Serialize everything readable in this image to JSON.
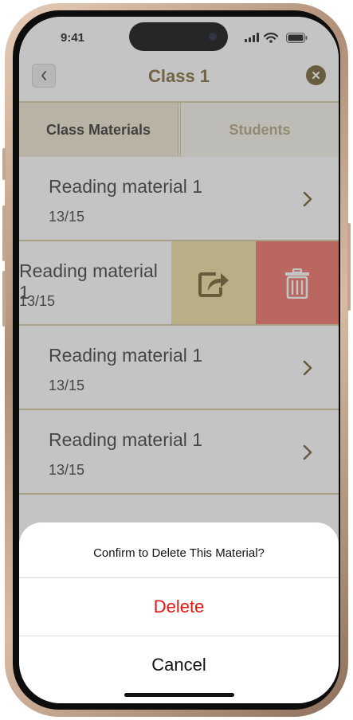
{
  "status_bar": {
    "time": "9:41"
  },
  "header": {
    "title": "Class 1"
  },
  "tabs": [
    {
      "label": "Class Materials",
      "active": true
    },
    {
      "label": "Students",
      "active": false
    }
  ],
  "materials": [
    {
      "title": "Reading material 1",
      "count": "13/15"
    },
    {
      "title": "Reading material 1",
      "count": "13/15",
      "swiped": true
    },
    {
      "title": "Reading material 1",
      "count": "13/15"
    },
    {
      "title": "Reading material 1",
      "count": "13/15"
    }
  ],
  "swipe_actions": {
    "share_icon": "share-icon",
    "delete_icon": "trash-icon"
  },
  "dialog": {
    "title": "Confirm to Delete This Material?",
    "delete_label": "Delete",
    "cancel_label": "Cancel"
  },
  "colors": {
    "accent": "#7a6330",
    "share_action": "#eede9c",
    "delete_action": "#ee6a5e",
    "destructive_text": "#e8140f"
  }
}
